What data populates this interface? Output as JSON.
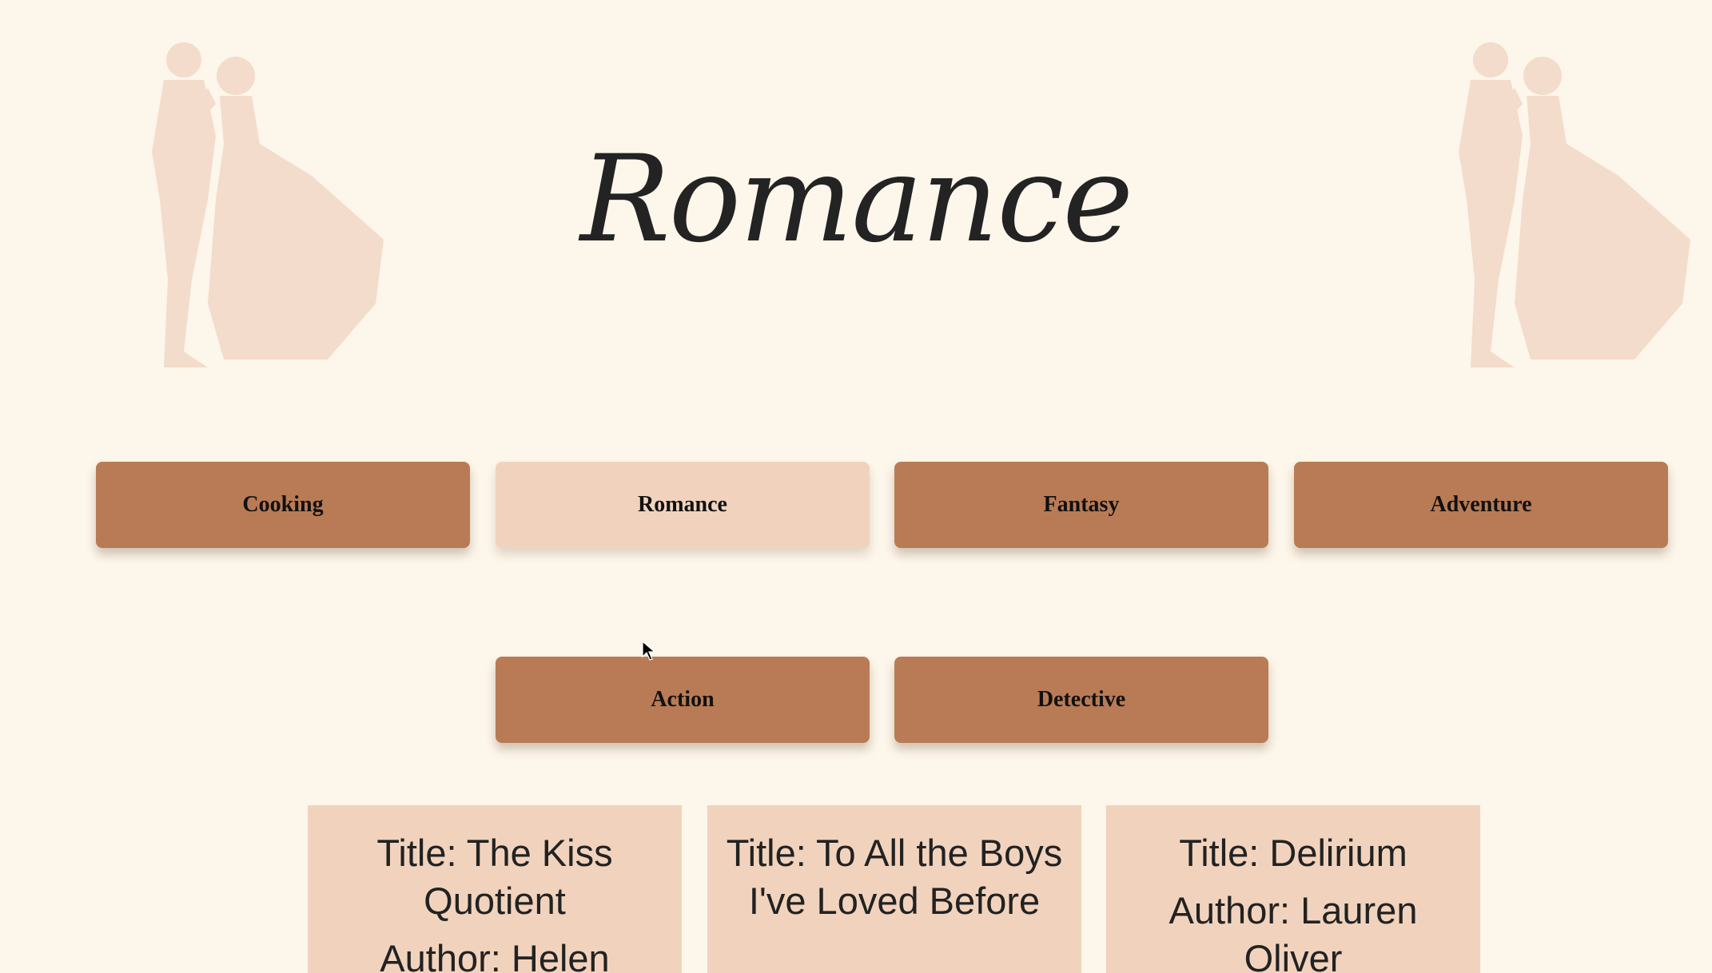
{
  "page": {
    "title": "Romance"
  },
  "colors": {
    "background": "#fdf6ea",
    "button": "#b97b55",
    "button_active": "#f1d3bd",
    "card": "#f1d3bd",
    "silhouette": "#f3dccb"
  },
  "genres": [
    {
      "label": "Cooking",
      "active": false
    },
    {
      "label": "Romance",
      "active": true
    },
    {
      "label": "Fantasy",
      "active": false
    },
    {
      "label": "Adventure",
      "active": false
    },
    {
      "label": "Action",
      "active": false
    },
    {
      "label": "Detective",
      "active": false
    }
  ],
  "books": [
    {
      "title": "Title: The Kiss Quotient",
      "author": "Author: Helen"
    },
    {
      "title": "Title: To All the Boys I've Loved Before",
      "author": ""
    },
    {
      "title": "Title: Delirium",
      "author": "Author: Lauren Oliver"
    }
  ],
  "icons": {
    "decor_left": "dancing-couple-icon",
    "decor_right": "dancing-couple-icon",
    "pointer": "mouse-cursor-icon"
  }
}
